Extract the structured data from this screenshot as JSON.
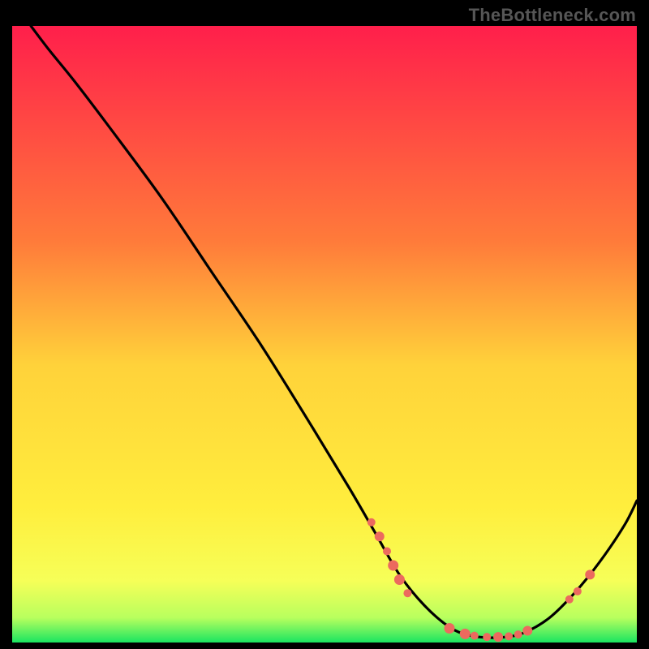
{
  "watermark": "TheBottleneck.com",
  "chart_data": {
    "type": "line",
    "title": "",
    "xlabel": "",
    "ylabel": "",
    "xlim": [
      0,
      100
    ],
    "ylim": [
      0,
      100
    ],
    "grid": false,
    "legend": false,
    "gradient_stops": [
      {
        "offset": 0,
        "color": "#ff1f4b"
      },
      {
        "offset": 35,
        "color": "#ff7b3a"
      },
      {
        "offset": 55,
        "color": "#ffd23a"
      },
      {
        "offset": 78,
        "color": "#ffee3d"
      },
      {
        "offset": 90,
        "color": "#f6ff58"
      },
      {
        "offset": 96,
        "color": "#b8ff5e"
      },
      {
        "offset": 100,
        "color": "#1ae561"
      }
    ],
    "series": [
      {
        "name": "bottleneck-curve",
        "color": "#000000",
        "x": [
          3,
          6,
          10,
          16,
          24,
          32,
          40,
          48,
          54,
          58,
          62,
          66,
          70,
          73,
          76,
          79,
          82,
          86,
          90,
          94,
          98,
          100
        ],
        "y": [
          100,
          96,
          91,
          83,
          72,
          60,
          48,
          35,
          25,
          18,
          11,
          6,
          2.5,
          1.2,
          0.8,
          0.9,
          1.6,
          4,
          8,
          13,
          19,
          23
        ]
      }
    ],
    "markers": [
      {
        "x": 57.5,
        "y": 19.5,
        "r": 5
      },
      {
        "x": 58.8,
        "y": 17.2,
        "r": 6
      },
      {
        "x": 60.0,
        "y": 14.8,
        "r": 5
      },
      {
        "x": 61.0,
        "y": 12.5,
        "r": 6.5
      },
      {
        "x": 62.0,
        "y": 10.2,
        "r": 6.5
      },
      {
        "x": 63.3,
        "y": 8.0,
        "r": 5
      },
      {
        "x": 70.0,
        "y": 2.3,
        "r": 6.5
      },
      {
        "x": 72.5,
        "y": 1.4,
        "r": 6.5
      },
      {
        "x": 74.0,
        "y": 1.1,
        "r": 5
      },
      {
        "x": 76.0,
        "y": 0.9,
        "r": 5
      },
      {
        "x": 77.8,
        "y": 0.9,
        "r": 6
      },
      {
        "x": 79.5,
        "y": 1.0,
        "r": 5
      },
      {
        "x": 81.0,
        "y": 1.3,
        "r": 5
      },
      {
        "x": 82.5,
        "y": 1.9,
        "r": 6
      },
      {
        "x": 89.2,
        "y": 7.0,
        "r": 5
      },
      {
        "x": 90.5,
        "y": 8.3,
        "r": 5
      },
      {
        "x": 92.5,
        "y": 11.0,
        "r": 6
      }
    ],
    "marker_color": "#ec6a5e"
  }
}
